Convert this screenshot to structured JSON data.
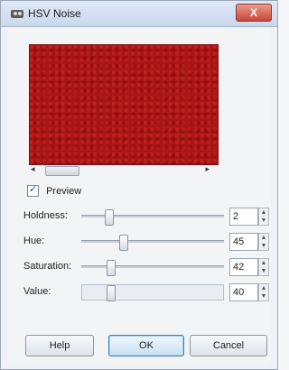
{
  "window": {
    "title": "HSV Noise",
    "close_label": "X"
  },
  "preview": {
    "checkbox_label": "Preview",
    "checked": true
  },
  "params": [
    {
      "label": "Holdness:",
      "value": "2",
      "level": 0.2
    },
    {
      "label": "Hue:",
      "value": "45",
      "level": 0.3
    },
    {
      "label": "Saturation:",
      "value": "42",
      "level": 0.16
    },
    {
      "label": "Value:",
      "value": "40",
      "level": 0.16
    }
  ],
  "buttons": {
    "help": "Help",
    "ok": "OK",
    "cancel": "Cancel"
  },
  "colors": {
    "preview_noise": "#a81616"
  }
}
